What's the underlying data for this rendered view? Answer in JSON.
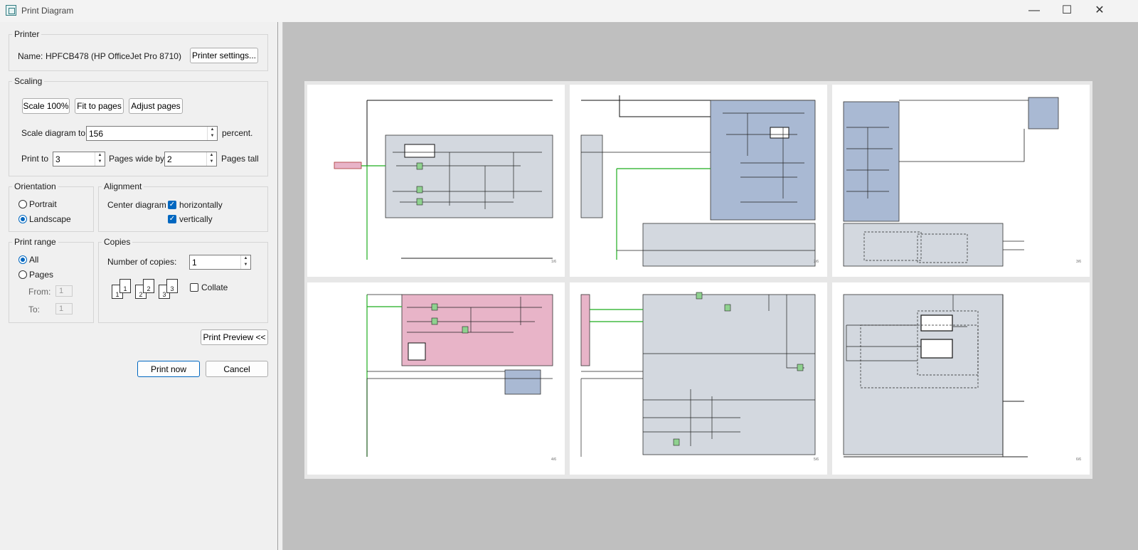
{
  "window": {
    "title": "Print Diagram",
    "minimize": "—",
    "maximize": "☐",
    "close": "✕"
  },
  "printer": {
    "legend": "Printer",
    "name_label": "Name:",
    "name_value": "HPFCB478 (HP OfficeJet Pro 8710)",
    "settings_button": "Printer settings..."
  },
  "scaling": {
    "legend": "Scaling",
    "scale_100_button": "Scale 100%",
    "fit_to_pages_button": "Fit to pages",
    "adjust_pages_button": "Adjust pages",
    "scale_label": "Scale diagram to",
    "scale_value": "156",
    "scale_suffix": "percent.",
    "print_to_label": "Print to",
    "pages_wide_value": "3",
    "pages_wide_label": "Pages wide by",
    "pages_tall_value": "2",
    "pages_tall_label": "Pages tall"
  },
  "orientation": {
    "legend": "Orientation",
    "portrait": "Portrait",
    "landscape": "Landscape",
    "selected": "landscape"
  },
  "alignment": {
    "legend": "Alignment",
    "center_label": "Center diagram",
    "horizontally": "horizontally",
    "vertically": "vertically",
    "horizontally_checked": true,
    "vertically_checked": true
  },
  "print_range": {
    "legend": "Print range",
    "all": "All",
    "pages": "Pages",
    "from_label": "From:",
    "from_value": "1",
    "to_label": "To:",
    "to_value": "1",
    "selected": "all"
  },
  "copies": {
    "legend": "Copies",
    "number_label": "Number of copies:",
    "number_value": "1",
    "collate_label": "Collate",
    "collate_checked": false,
    "collate_icon_labels": [
      "1",
      "1",
      "2",
      "2",
      "3",
      "3"
    ]
  },
  "actions": {
    "print_preview": "Print Preview <<",
    "print_now": "Print now",
    "cancel": "Cancel"
  },
  "preview": {
    "page_labels": [
      "1/6",
      "2/6",
      "3/6",
      "4/6",
      "5/6",
      "6/6"
    ]
  },
  "colors": {
    "accent": "#0067c0",
    "preview_bg": "#bfbfbf",
    "diagram_gray": "#d3d8df",
    "diagram_blue": "#a9b9d3",
    "diagram_pink": "#e8b4c8",
    "wire_green": "#1fae1f"
  }
}
